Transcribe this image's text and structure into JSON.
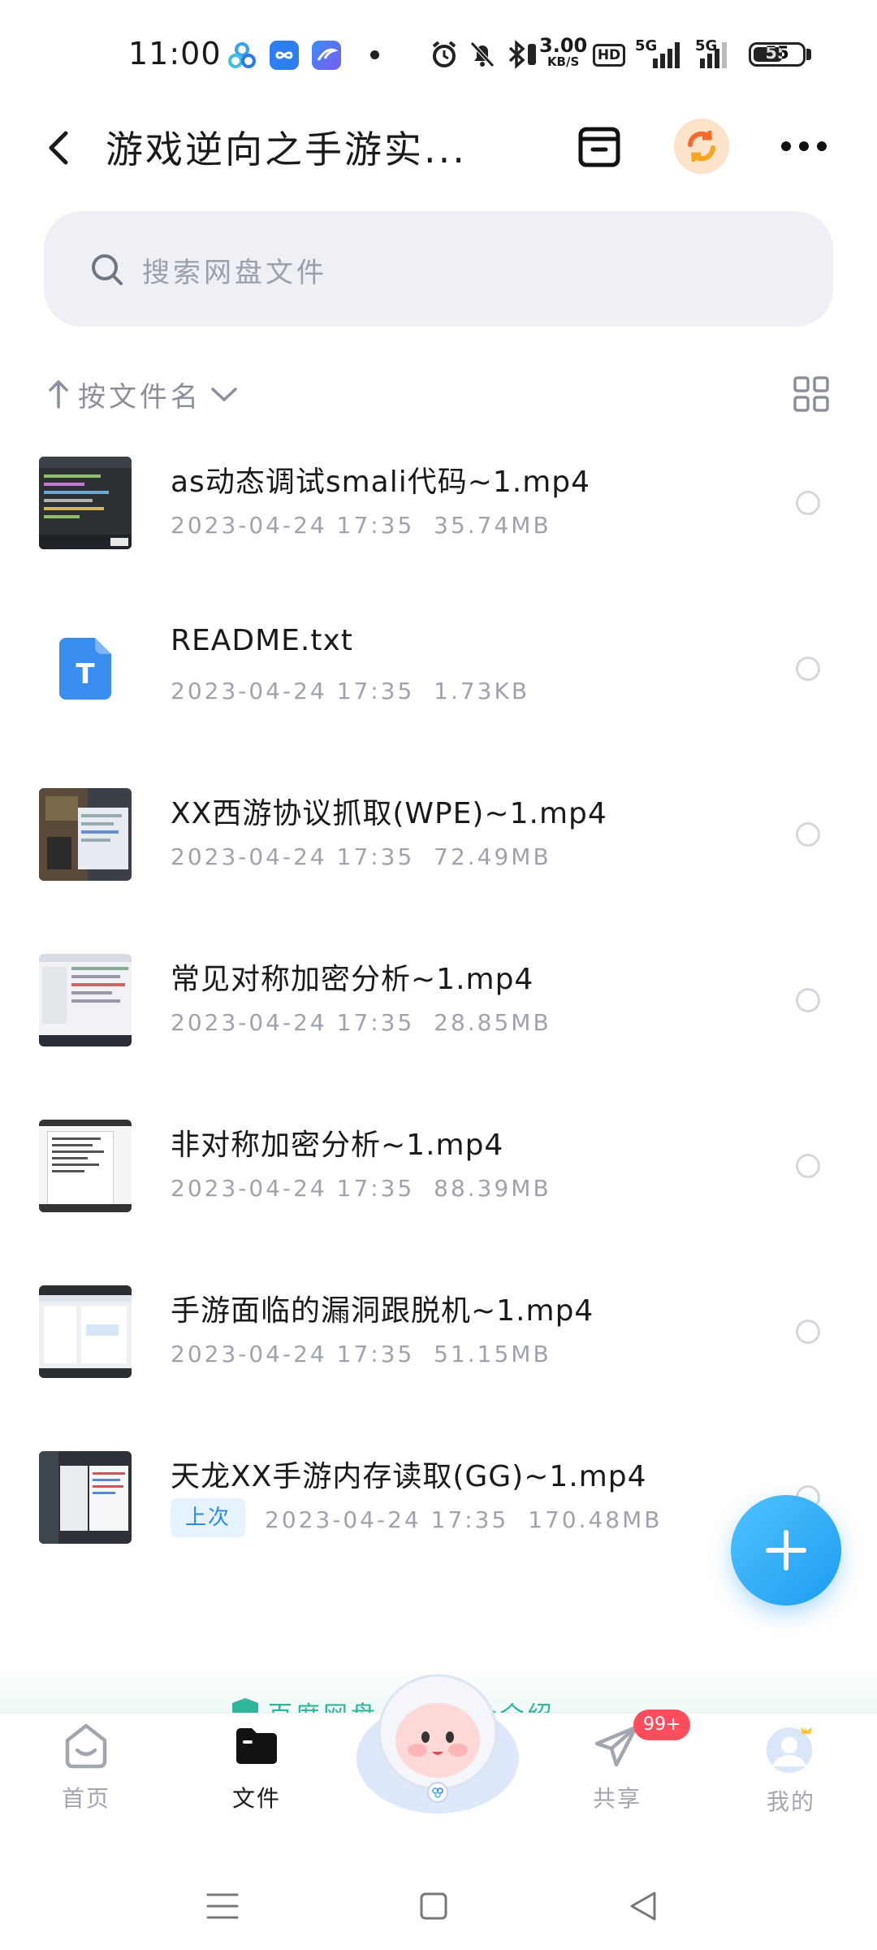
{
  "status_bar": {
    "time": "11:00",
    "net_speed_value": "3.00",
    "net_speed_unit": "KB/S",
    "hd_label": "HD",
    "signal1": "5G",
    "signal2": "5G",
    "battery": "55",
    "icons": [
      "baidu-app-icon",
      "infinity-app-icon",
      "feather-app-icon",
      "alarm-icon",
      "mute-bell-icon",
      "bluetooth-icon",
      "vibrate-icon"
    ]
  },
  "header": {
    "title": "游戏逆向之手游实...",
    "icons": [
      "back-icon",
      "inbox-icon",
      "sync-icon",
      "more-icon"
    ]
  },
  "search": {
    "placeholder": "搜索网盘文件"
  },
  "sort": {
    "label": "按文件名"
  },
  "files": [
    {
      "name": "as动态调试smali代码~1.mp4",
      "date": "2023-04-24  17:35",
      "size": "35.74MB",
      "type": "video"
    },
    {
      "name": "README.txt",
      "date": "2023-04-24  17:35",
      "size": "1.73KB",
      "type": "text",
      "icon_letter": "T"
    },
    {
      "name": "XX西游协议抓取(WPE)~1.mp4",
      "date": "2023-04-24  17:35",
      "size": "72.49MB",
      "type": "video"
    },
    {
      "name": "常见对称加密分析~1.mp4",
      "date": "2023-04-24  17:35",
      "size": "28.85MB",
      "type": "video"
    },
    {
      "name": "非对称加密分析~1.mp4",
      "date": "2023-04-24  17:35",
      "size": "88.39MB",
      "type": "video"
    },
    {
      "name": "手游面临的漏洞跟脱机~1.mp4",
      "date": "2023-04-24  17:35",
      "size": "51.15MB",
      "type": "video"
    },
    {
      "name": "天龙XX手游内存读取(GG)~1.mp4",
      "date": "2023-04-24  17:35",
      "size": "170.48MB",
      "type": "video",
      "tag": "上次"
    }
  ],
  "banner": {
    "text": "百度网盘 数据安全介绍"
  },
  "bottom_nav": {
    "items": [
      {
        "label": "首页",
        "active": false
      },
      {
        "label": "文件",
        "active": true
      },
      {
        "label": "共享",
        "active": false,
        "badge": "99+"
      },
      {
        "label": "我的",
        "active": false
      }
    ]
  },
  "colors": {
    "accent": "#1d9cf0",
    "badge": "#ff4d5e",
    "tag_text": "#2c8be3",
    "txt_icon": "#3a8ef0"
  }
}
